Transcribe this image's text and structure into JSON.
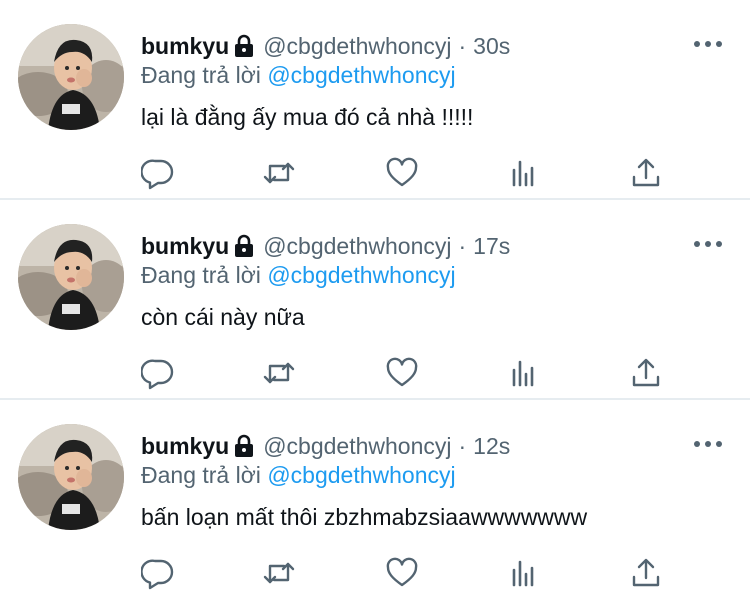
{
  "colors": {
    "text": "#0f1419",
    "secondary": "#536471",
    "link": "#1d9bf0",
    "divider": "#e6ecf0",
    "background": "#ffffff"
  },
  "icons": {
    "lock": "lock-icon",
    "more": "more-horizontal-icon",
    "reply": "reply-icon",
    "retweet": "retweet-icon",
    "like": "heart-icon",
    "analytics": "analytics-icon",
    "share": "share-icon"
  },
  "tweets": [
    {
      "name": "bumkyu",
      "handle": "@cbgdethwhoncyj",
      "separator": "·",
      "time": "30s",
      "reply_prefix": "Đang trả lời",
      "reply_to": "@cbgdethwhoncyj",
      "text": "lại là đằng ấy mua đó cả nhà !!!!!"
    },
    {
      "name": "bumkyu",
      "handle": "@cbgdethwhoncyj",
      "separator": "·",
      "time": "17s",
      "reply_prefix": "Đang trả lời",
      "reply_to": "@cbgdethwhoncyj",
      "text": "còn cái này nữa"
    },
    {
      "name": "bumkyu",
      "handle": "@cbgdethwhoncyj",
      "separator": "·",
      "time": "12s",
      "reply_prefix": "Đang trả lời",
      "reply_to": "@cbgdethwhoncyj",
      "text": "bấn loạn mất thôi zbzhmabzsiaawwwwwww"
    }
  ]
}
